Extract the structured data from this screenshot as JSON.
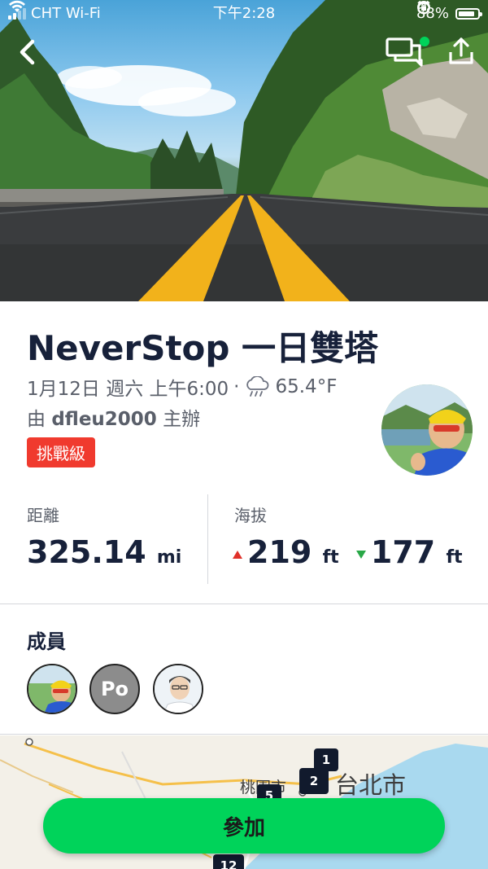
{
  "status_bar": {
    "carrier": "CHT Wi-Fi",
    "time": "下午2:28",
    "battery": "88%",
    "battery_level": 0.88
  },
  "event": {
    "title": "NeverStop  一日雙塔",
    "date": "1月12日 週六 上午6:00",
    "weather_temp": "65.4°F",
    "organizer_prefix": "由",
    "organizer_name": "dfleu2000",
    "organizer_suffix": "主辦",
    "level_badge": "挑戰級"
  },
  "stats": {
    "distance_label": "距離",
    "distance_value": "325.14",
    "distance_unit": "mi",
    "elevation_label": "海拔",
    "elevation_gain": "219",
    "elevation_gain_unit": "ft",
    "elevation_loss": "177",
    "elevation_loss_unit": "ft"
  },
  "members": {
    "title": "成員",
    "items": [
      {
        "type": "photo"
      },
      {
        "type": "initials",
        "initials": "Po"
      },
      {
        "type": "photo"
      }
    ]
  },
  "map": {
    "labels": {
      "taipei": "台北市",
      "taoyuan": "桃園市"
    },
    "pins": [
      "1",
      "2",
      "5",
      "12"
    ]
  },
  "actions": {
    "join_label": "參加"
  },
  "colors": {
    "badge": "#f03a2e",
    "join_button": "#00d35a",
    "elevation_up": "#e0312a",
    "elevation_down": "#29a847",
    "notification_dot": "#00d35a"
  },
  "icons": [
    "back-icon",
    "chat-icon",
    "share-icon",
    "rain-cloud-icon",
    "wifi-icon",
    "alarm-icon",
    "rotation-lock-icon"
  ]
}
